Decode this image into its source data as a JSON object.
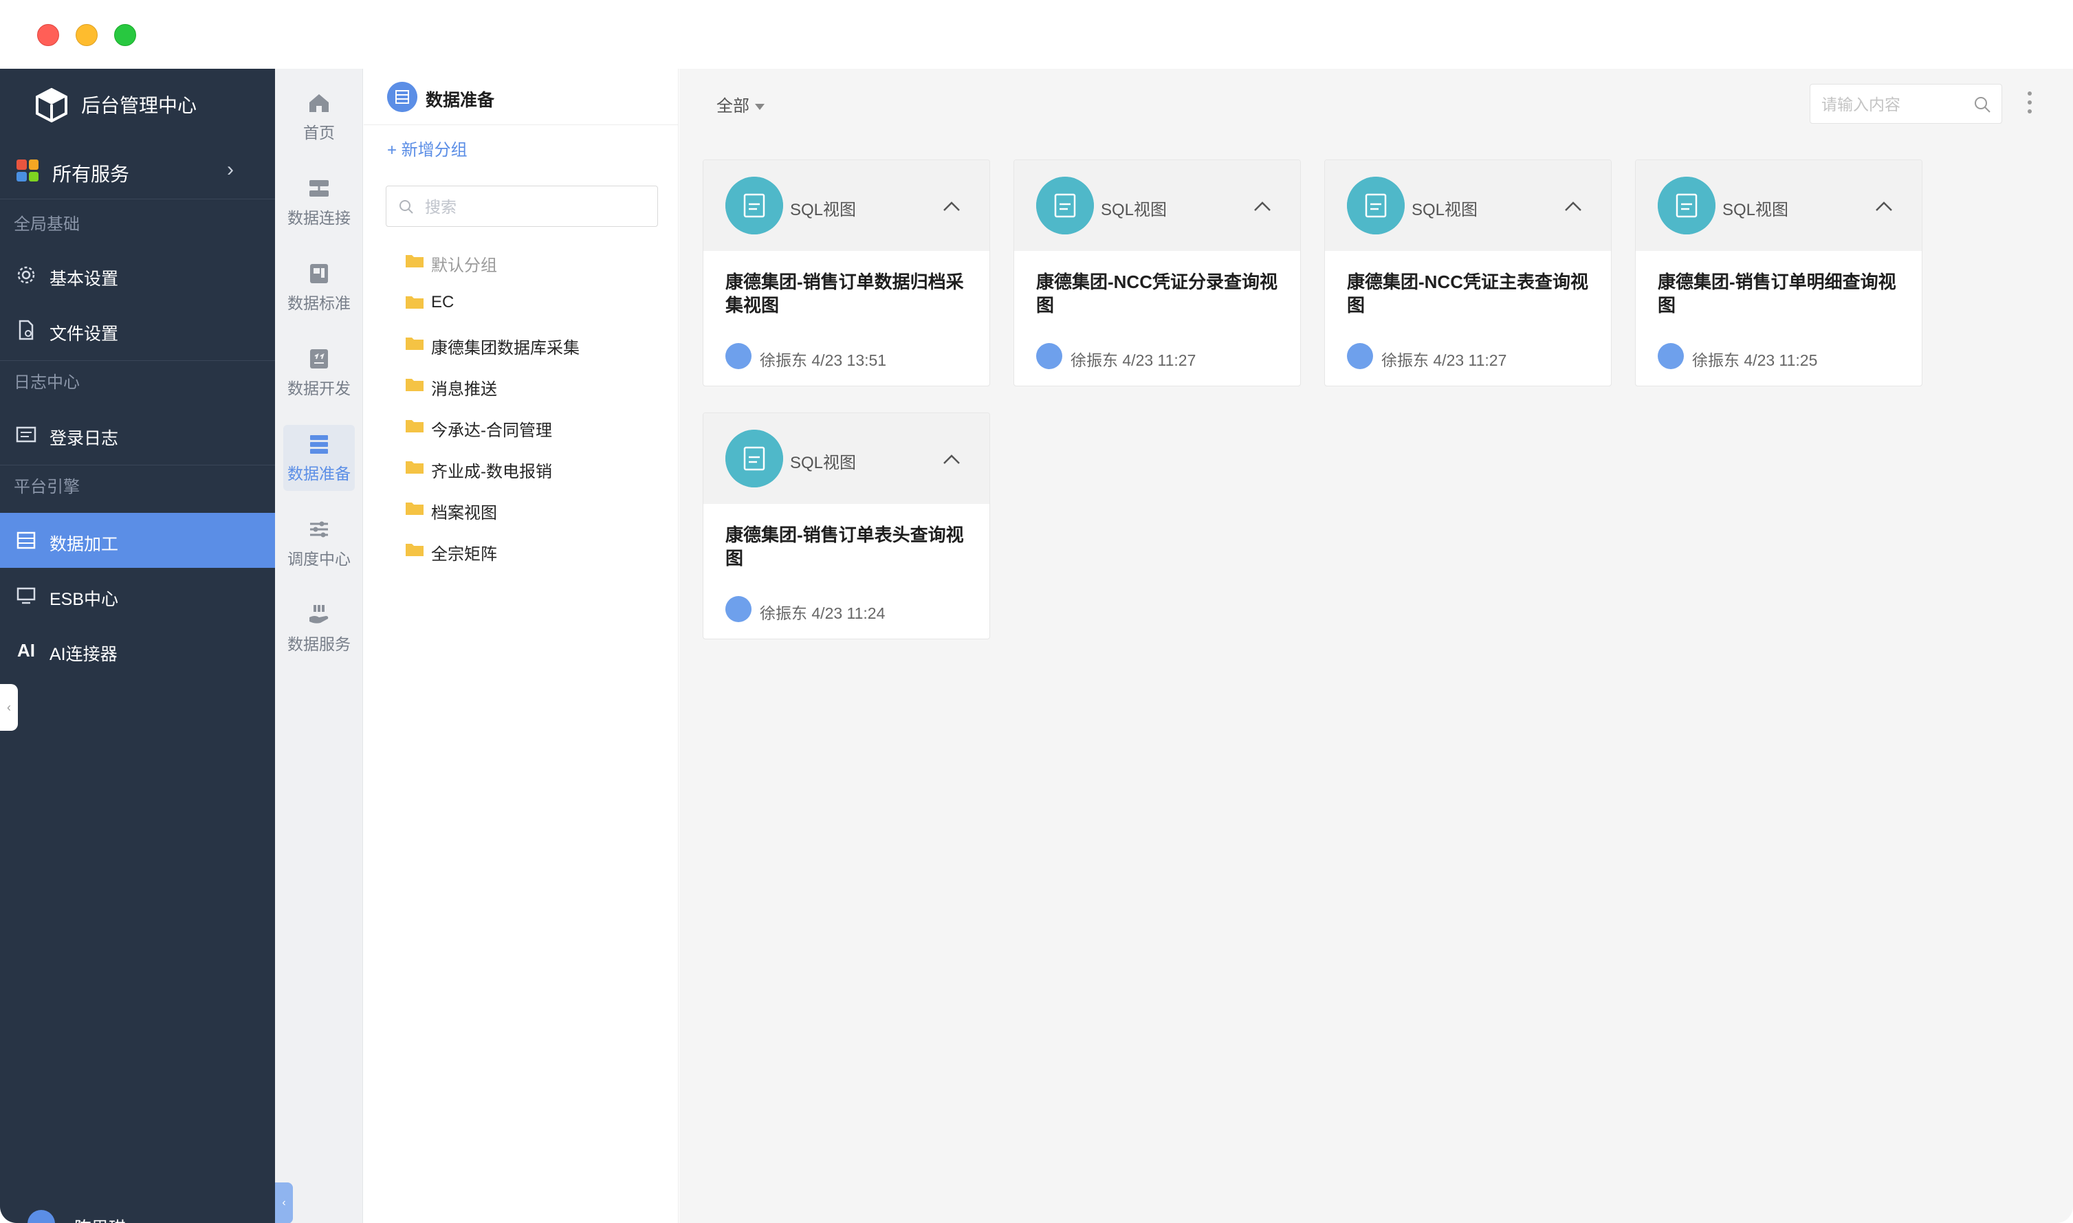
{
  "sidebar": {
    "brand_title": "后台管理中心",
    "services_label": "所有服务",
    "sections": {
      "global": "全局基础",
      "logs": "日志中心",
      "engine": "平台引擎"
    },
    "items": {
      "basic_settings": "基本设置",
      "file_settings": "文件设置",
      "login_log": "登录日志",
      "data_processing": "数据加工",
      "esb_center": "ESB中心",
      "ai_connector": "AI连接器",
      "ai_glyph": "AI"
    },
    "user_name": "陈思琪",
    "active_color": "#5b8ee6"
  },
  "rail": {
    "items": [
      {
        "label": "首页",
        "icon": "home-icon"
      },
      {
        "label": "数据连接",
        "icon": "data-connect-icon"
      },
      {
        "label": "数据标准",
        "icon": "data-standard-icon"
      },
      {
        "label": "数据开发",
        "icon": "data-dev-icon"
      },
      {
        "label": "数据准备",
        "icon": "data-prep-icon"
      },
      {
        "label": "调度中心",
        "icon": "schedule-icon"
      },
      {
        "label": "数据服务",
        "icon": "data-service-icon"
      }
    ],
    "active": "数据准备"
  },
  "tree": {
    "title": "数据准备",
    "add_group": "+ 新增分组",
    "search_placeholder": "搜索",
    "folders": [
      "默认分组",
      "EC",
      "康德集团数据库采集",
      "消息推送",
      "今承达-合同管理",
      "齐业成-数电报销",
      "档案视图",
      "全宗矩阵"
    ]
  },
  "main": {
    "filter_label": "全部",
    "search_placeholder": "请输入内容",
    "cards": [
      {
        "type": "SQL视图",
        "title": "康德集团-销售订单数据归档采集视图",
        "author": "徐振东",
        "time": "4/23 13:51"
      },
      {
        "type": "SQL视图",
        "title": "康德集团-NCC凭证分录查询视图",
        "author": "徐振东",
        "time": "4/23 11:27"
      },
      {
        "type": "SQL视图",
        "title": "康德集团-NCC凭证主表查询视图",
        "author": "徐振东",
        "time": "4/23 11:27"
      },
      {
        "type": "SQL视图",
        "title": "康德集团-销售订单明细查询视图",
        "author": "徐振东",
        "time": "4/23 11:25"
      },
      {
        "type": "SQL视图",
        "title": "康德集团-销售订单表头查询视图",
        "author": "徐振东",
        "time": "4/23 11:24"
      }
    ],
    "card_icon_color": "#4fb8c9"
  }
}
